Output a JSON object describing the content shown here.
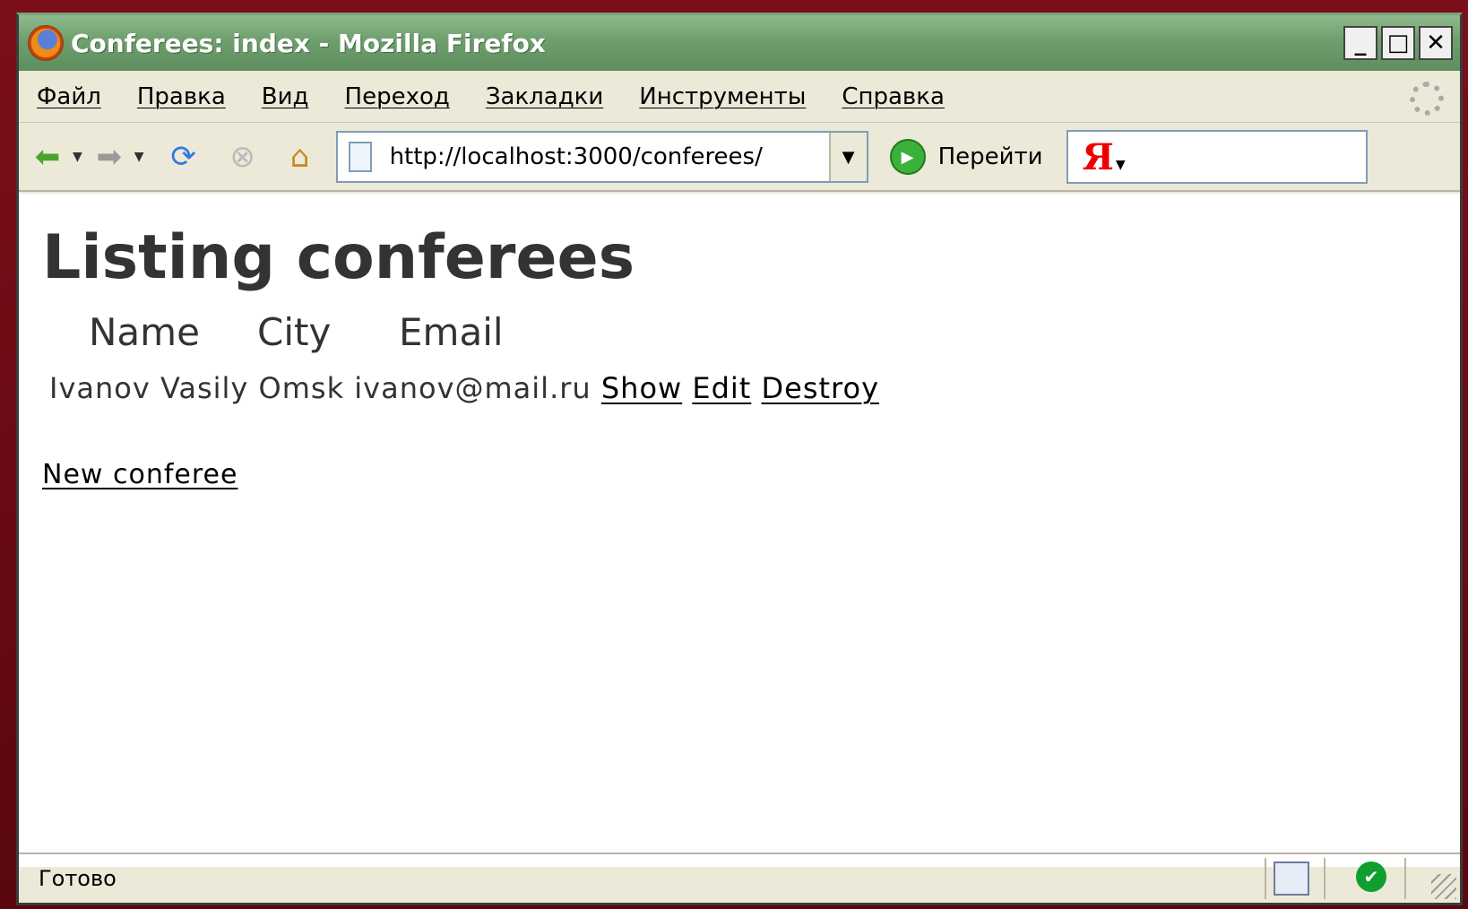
{
  "window": {
    "title": "Conferees: index - Mozilla Firefox",
    "controls": {
      "minimize": "_",
      "maximize": "□",
      "close": "✕"
    }
  },
  "menubar": {
    "items": [
      "Файл",
      "Правка",
      "Вид",
      "Переход",
      "Закладки",
      "Инструменты",
      "Справка"
    ]
  },
  "navbar": {
    "url": "http://localhost:3000/conferees/",
    "go_label": "Перейти",
    "search_logo": "Я"
  },
  "page": {
    "title": "Listing conferees",
    "columns": [
      "Name",
      "City",
      "Email"
    ],
    "rows": [
      {
        "name": "Ivanov Vasily",
        "city": "Omsk",
        "email": "ivanov@mail.ru",
        "actions": [
          "Show",
          "Edit",
          "Destroy"
        ]
      }
    ],
    "new_link": "New conferee"
  },
  "statusbar": {
    "text": "Готово"
  },
  "icons": {
    "back": "arrow-left-icon",
    "forward": "arrow-right-icon",
    "reload": "reload-icon",
    "stop": "stop-icon",
    "home": "home-icon"
  }
}
